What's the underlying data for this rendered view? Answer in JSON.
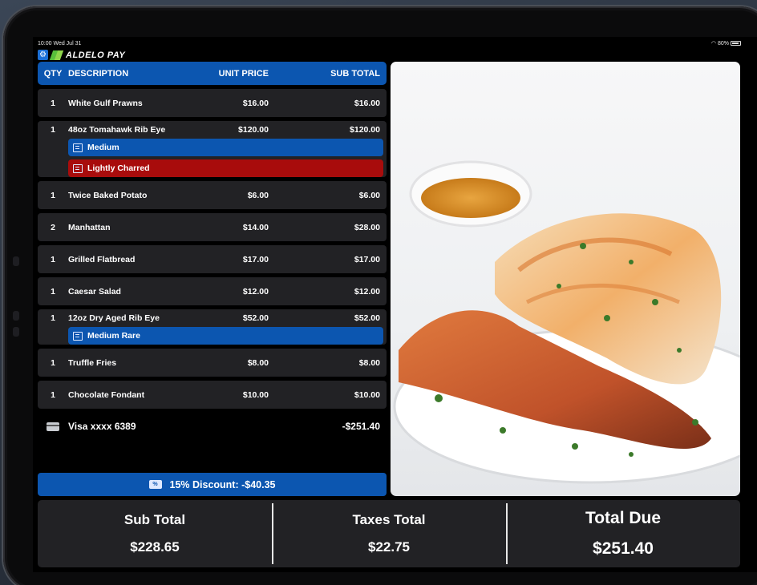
{
  "status_bar": {
    "time": "10:00 Wed Jul 31",
    "battery": "80%"
  },
  "brand": {
    "name": "ALDELO PAY"
  },
  "order": {
    "headers": {
      "qty": "QTY",
      "description": "DESCRIPTION",
      "unit_price": "UNIT PRICE",
      "sub_total": "SUB TOTAL"
    },
    "items": [
      {
        "qty": "1",
        "description": "White Gulf Prawns",
        "unit_price": "$16.00",
        "sub_total": "$16.00"
      },
      {
        "qty": "1",
        "description": "48oz Tomahawk Rib Eye",
        "unit_price": "$120.00",
        "sub_total": "$120.00",
        "mods": [
          {
            "label": "Medium",
            "kind": "blue"
          },
          {
            "label": "Lightly Charred",
            "kind": "red"
          }
        ]
      },
      {
        "qty": "1",
        "description": "Twice Baked Potato",
        "unit_price": "$6.00",
        "sub_total": "$6.00"
      },
      {
        "qty": "2",
        "description": "Manhattan",
        "unit_price": "$14.00",
        "sub_total": "$28.00"
      },
      {
        "qty": "1",
        "description": "Grilled Flatbread",
        "unit_price": "$17.00",
        "sub_total": "$17.00"
      },
      {
        "qty": "1",
        "description": "Caesar Salad",
        "unit_price": "$12.00",
        "sub_total": "$12.00"
      },
      {
        "qty": "1",
        "description": "12oz Dry Aged Rib Eye",
        "unit_price": "$52.00",
        "sub_total": "$52.00",
        "mods": [
          {
            "label": "Medium Rare",
            "kind": "blue"
          }
        ]
      },
      {
        "qty": "1",
        "description": "Truffle Fries",
        "unit_price": "$8.00",
        "sub_total": "$8.00"
      },
      {
        "qty": "1",
        "description": "Chocolate Fondant",
        "unit_price": "$10.00",
        "sub_total": "$10.00"
      }
    ],
    "payment": {
      "description": "Visa xxxx 6389",
      "amount": "-$251.40",
      "icon": "card-icon"
    }
  },
  "discount": {
    "label": "15% Discount: -$40.35",
    "icon": "discount-icon"
  },
  "totals": {
    "sub_total_label": "Sub Total",
    "sub_total": "$228.65",
    "taxes_label": "Taxes Total",
    "taxes": "$22.75",
    "due_label": "Total Due",
    "due": "$251.40"
  },
  "colors": {
    "accent_blue": "#0c56b0",
    "modifier_red": "#a80c0c",
    "row_bg": "#222225"
  }
}
